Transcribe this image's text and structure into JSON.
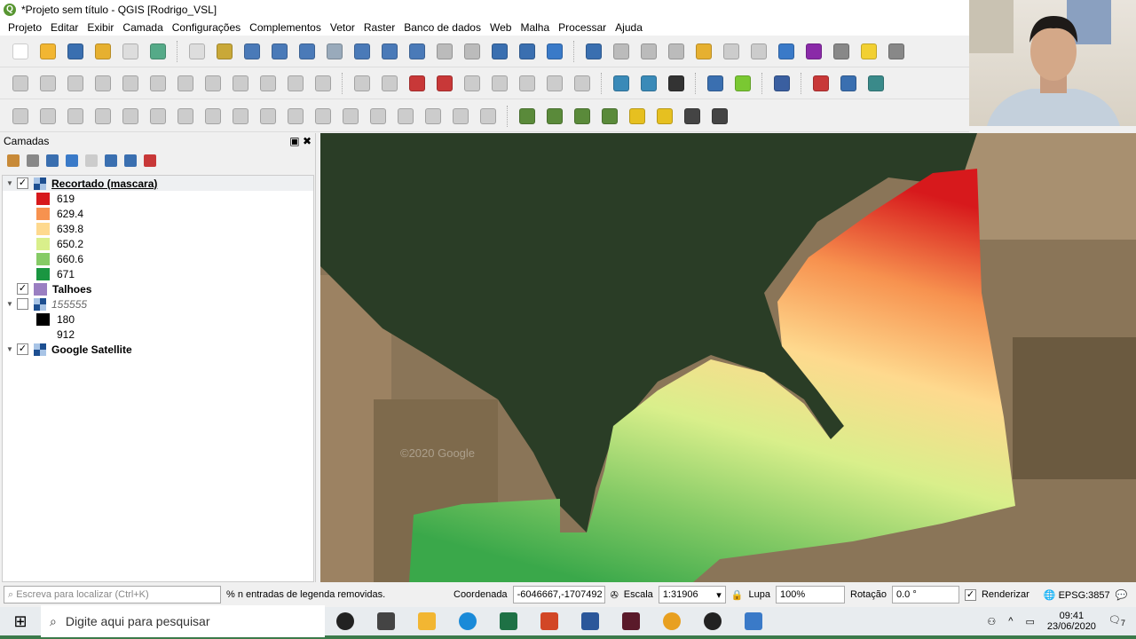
{
  "window": {
    "title": "*Projeto sem título - QGIS [Rodrigo_VSL]"
  },
  "menu": [
    "Projeto",
    "Editar",
    "Exibir",
    "Camada",
    "Configurações",
    "Complementos",
    "Vetor",
    "Raster",
    "Banco de dados",
    "Web",
    "Malha",
    "Processar",
    "Ajuda"
  ],
  "toolbars": [
    [
      [
        "new-project-icon",
        "#fff"
      ],
      [
        "open-project-icon",
        "#f2b632"
      ],
      [
        "save-project-icon",
        "#3a6fb0"
      ],
      [
        "save-as-icon",
        "#e6b030"
      ],
      [
        "print-layout-icon",
        "#ddd"
      ],
      [
        "style-manager-icon",
        "#5a8"
      ],
      "|",
      [
        "pan-icon",
        "#ddd"
      ],
      [
        "pan-to-selection-icon",
        "#c9a838"
      ],
      [
        "zoom-in-icon",
        "#4a7ab8"
      ],
      [
        "zoom-out-icon",
        "#4a7ab8"
      ],
      [
        "zoom-full-icon",
        "#4a7ab8"
      ],
      [
        "zoom-selection-icon",
        "#9ab"
      ],
      [
        "zoom-layer-icon",
        "#4a7ab8"
      ],
      [
        "zoom-native-icon",
        "#4a7ab8"
      ],
      [
        "zoom-last-icon",
        "#4a7ab8"
      ],
      [
        "zoom-next-icon",
        "#bbb"
      ],
      [
        "new-map-view-icon",
        "#bbb"
      ],
      [
        "bookmark-icon",
        "#3a6fb0"
      ],
      [
        "show-bookmarks-icon",
        "#3a6fb0"
      ],
      [
        "refresh-icon",
        "#3a7ac8"
      ],
      "|",
      [
        "identify-icon",
        "#3a6fb0"
      ],
      [
        "run-action-icon",
        "#bbb"
      ],
      [
        "select-features-icon",
        "#bbb"
      ],
      [
        "select-by-value-icon",
        "#bbb"
      ],
      [
        "deselect-icon",
        "#e6b030"
      ],
      [
        "attribute-table-icon",
        "#ccc"
      ],
      [
        "field-calculator-icon",
        "#ccc"
      ],
      [
        "toolbox-icon",
        "#3a7ac8"
      ],
      [
        "statistics-icon",
        "#8a2aa8"
      ],
      [
        "measure-icon",
        "#888"
      ],
      [
        "map-tips-icon",
        "#f2d032"
      ],
      [
        "text-annotation-icon",
        "#888"
      ]
    ],
    [
      [
        "current-edits-icon",
        "#ccc"
      ],
      [
        "toggle-editing-icon",
        "#ccc"
      ],
      [
        "save-edits-icon",
        "#ccc"
      ],
      [
        "add-feature-icon",
        "#ccc"
      ],
      [
        "vertex-tool-icon",
        "#ccc"
      ],
      [
        "modify-attributes-icon",
        "#ccc"
      ],
      [
        "delete-selected-icon",
        "#ccc"
      ],
      [
        "cut-icon",
        "#ccc"
      ],
      [
        "copy-icon",
        "#ccc"
      ],
      [
        "paste-icon",
        "#ccc"
      ],
      [
        "undo-icon",
        "#ccc"
      ],
      [
        "redo-icon",
        "#ccc"
      ],
      "|",
      [
        "label-toolbar-icon",
        "#ccc"
      ],
      [
        "pin-labels-icon",
        "#ccc"
      ],
      [
        "layer-labeling-icon",
        "#c83838"
      ],
      [
        "highlight-labels-icon",
        "#c83838"
      ],
      [
        "show-hide-labels-icon",
        "#ccc"
      ],
      [
        "move-label-icon",
        "#ccc"
      ],
      [
        "rotate-label-icon",
        "#ccc"
      ],
      [
        "change-label-icon",
        "#ccc"
      ],
      [
        "label-props-icon",
        "#ccc"
      ],
      "|",
      [
        "add-wms-icon",
        "#3a8ab8"
      ],
      [
        "add-wcs-icon",
        "#3a8ab8"
      ],
      [
        "add-wfs-icon",
        "#333"
      ],
      "|",
      [
        "python-console-icon",
        "#3a6fb0"
      ],
      [
        "quickmapservices-icon",
        "#7ac832"
      ],
      "|",
      [
        "help-icon",
        "#3a5fa0"
      ],
      "|",
      [
        "georeferencer-icon",
        "#c83838"
      ],
      [
        "coordinate-capture-icon",
        "#3a6fb0"
      ],
      [
        "plugin-icon",
        "#3a8a8a"
      ]
    ],
    [
      [
        "digitize-icon",
        "#ccc"
      ],
      [
        "add-ring-icon",
        "#ccc"
      ],
      [
        "add-part-icon",
        "#ccc"
      ],
      [
        "fill-ring-icon",
        "#ccc"
      ],
      [
        "delete-ring-icon",
        "#ccc"
      ],
      [
        "delete-part-icon",
        "#ccc"
      ],
      [
        "reshape-icon",
        "#ccc"
      ],
      [
        "offset-curve-icon",
        "#ccc"
      ],
      [
        "split-features-icon",
        "#ccc"
      ],
      [
        "split-parts-icon",
        "#ccc"
      ],
      [
        "merge-features-icon",
        "#ccc"
      ],
      [
        "merge-attributes-icon",
        "#ccc"
      ],
      [
        "rotate-symbols-icon",
        "#ccc"
      ],
      [
        "simplify-icon",
        "#ccc"
      ],
      [
        "add-circular-icon",
        "#ccc"
      ],
      [
        "reverse-line-icon",
        "#ccc"
      ],
      [
        "trim-extend-icon",
        "#ccc"
      ],
      [
        "advanced-digitize-icon",
        "#ccc"
      ],
      "|",
      [
        "raster-histogram-icon",
        "#5a8a3a"
      ],
      [
        "raster-local-icon",
        "#5a8a3a"
      ],
      [
        "raster-full-icon",
        "#5a8a3a"
      ],
      [
        "raster-stretch-icon",
        "#5a8a3a"
      ],
      [
        "brightness-up-icon",
        "#e6c020"
      ],
      [
        "brightness-down-icon",
        "#e6c020"
      ],
      [
        "contrast-up-icon",
        "#444"
      ],
      [
        "contrast-down-icon",
        "#444"
      ]
    ]
  ],
  "layers_panel": {
    "title": "Camadas",
    "tools": [
      [
        "style-panel-icon",
        "#c88a38"
      ],
      [
        "add-group-icon",
        "#888"
      ],
      [
        "visibility-icon",
        "#3a6fb0"
      ],
      [
        "filter-legend-icon",
        "#3a7ac8"
      ],
      [
        "filter-expression-icon",
        "#ccc"
      ],
      [
        "expand-all-icon",
        "#3a6fb0"
      ],
      [
        "collapse-all-icon",
        "#3a6fb0"
      ],
      [
        "remove-layer-icon",
        "#c83838"
      ]
    ],
    "layers": [
      {
        "name": "Recortado (mascara)",
        "checked": true,
        "legend": [
          {
            "label": "619",
            "color": "#d7191c"
          },
          {
            "label": "629.4",
            "color": "#f7924f"
          },
          {
            "label": "639.8",
            "color": "#fed98e"
          },
          {
            "label": "650.2",
            "color": "#d9ef8b"
          },
          {
            "label": "660.6",
            "color": "#86cb66"
          },
          {
            "label": "671",
            "color": "#1a9641"
          }
        ]
      },
      {
        "name": "Talhoes",
        "checked": true,
        "color": "#9a7fc2"
      },
      {
        "name": "155555",
        "checked": false,
        "legend": [
          {
            "label": "180",
            "color": "#000000"
          },
          {
            "label": "912",
            "color": "#ffffff"
          }
        ]
      },
      {
        "name": "Google Satellite",
        "checked": true
      }
    ]
  },
  "map": {
    "watermark": "©2020 Google"
  },
  "status": {
    "locator_placeholder": "Escreva para localizar (Ctrl+K)",
    "message": "% n entradas de legenda removidas.",
    "coord_label": "Coordenada",
    "coord": "-6046667,-1707492",
    "scale_label": "Escala",
    "scale": "1:31906",
    "magnifier_label": "Lupa",
    "magnifier": "100%",
    "rotation_label": "Rotação",
    "rotation": "0.0 °",
    "render_label": "Renderizar",
    "crs": "EPSG:3857"
  },
  "taskbar": {
    "search_placeholder": "Digite aqui para pesquisar",
    "apps": [
      [
        "cortana-icon",
        "#222"
      ],
      [
        "task-view-icon",
        "#444"
      ],
      [
        "file-explorer-icon",
        "#f2b632"
      ],
      [
        "skype-icon",
        "#1a8ad8"
      ],
      [
        "excel-icon",
        "#1e7145"
      ],
      [
        "powerpoint-icon",
        "#d24726"
      ],
      [
        "word-icon",
        "#2b579a"
      ],
      [
        "app-icon",
        "#5a1a2a"
      ],
      [
        "chrome-icon",
        "#e8a020"
      ],
      [
        "obs-icon",
        "#222"
      ],
      [
        "qgis-taskbar-icon",
        "#3a7ac8"
      ]
    ],
    "time": "09:41",
    "date": "23/06/2020",
    "notifications": "7"
  }
}
